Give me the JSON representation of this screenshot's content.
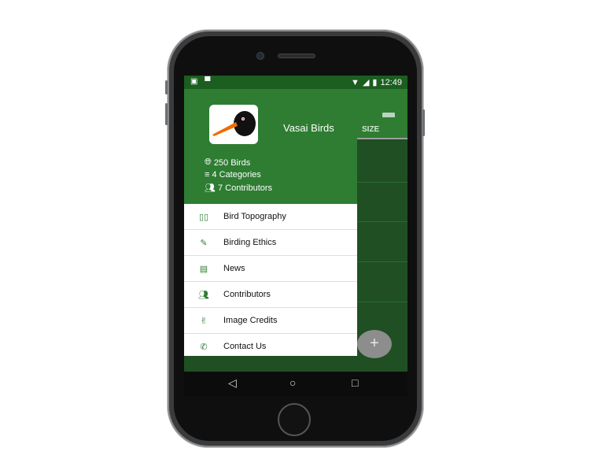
{
  "status_bar": {
    "time": "12:49"
  },
  "drawer": {
    "app_name": "Vasai Birds",
    "stats": [
      {
        "icon": "globe-icon",
        "text": "250 Birds"
      },
      {
        "icon": "list-icon",
        "text": "4 Categories"
      },
      {
        "icon": "group-icon",
        "text": "7 Contributors"
      }
    ],
    "menu": [
      {
        "icon": "map-icon",
        "label": "Bird Topography"
      },
      {
        "icon": "pencil-icon",
        "label": "Birding Ethics"
      },
      {
        "icon": "newspaper-icon",
        "label": "News"
      },
      {
        "icon": "group-icon",
        "label": "Contributors"
      },
      {
        "icon": "peace-icon",
        "label": "Image Credits"
      },
      {
        "icon": "phone-icon",
        "label": "Contact Us"
      }
    ]
  },
  "background": {
    "tab_label": "SIZE",
    "fab_label": "+"
  },
  "navbar": {
    "back": "◁",
    "home": "○",
    "recents": "□"
  }
}
